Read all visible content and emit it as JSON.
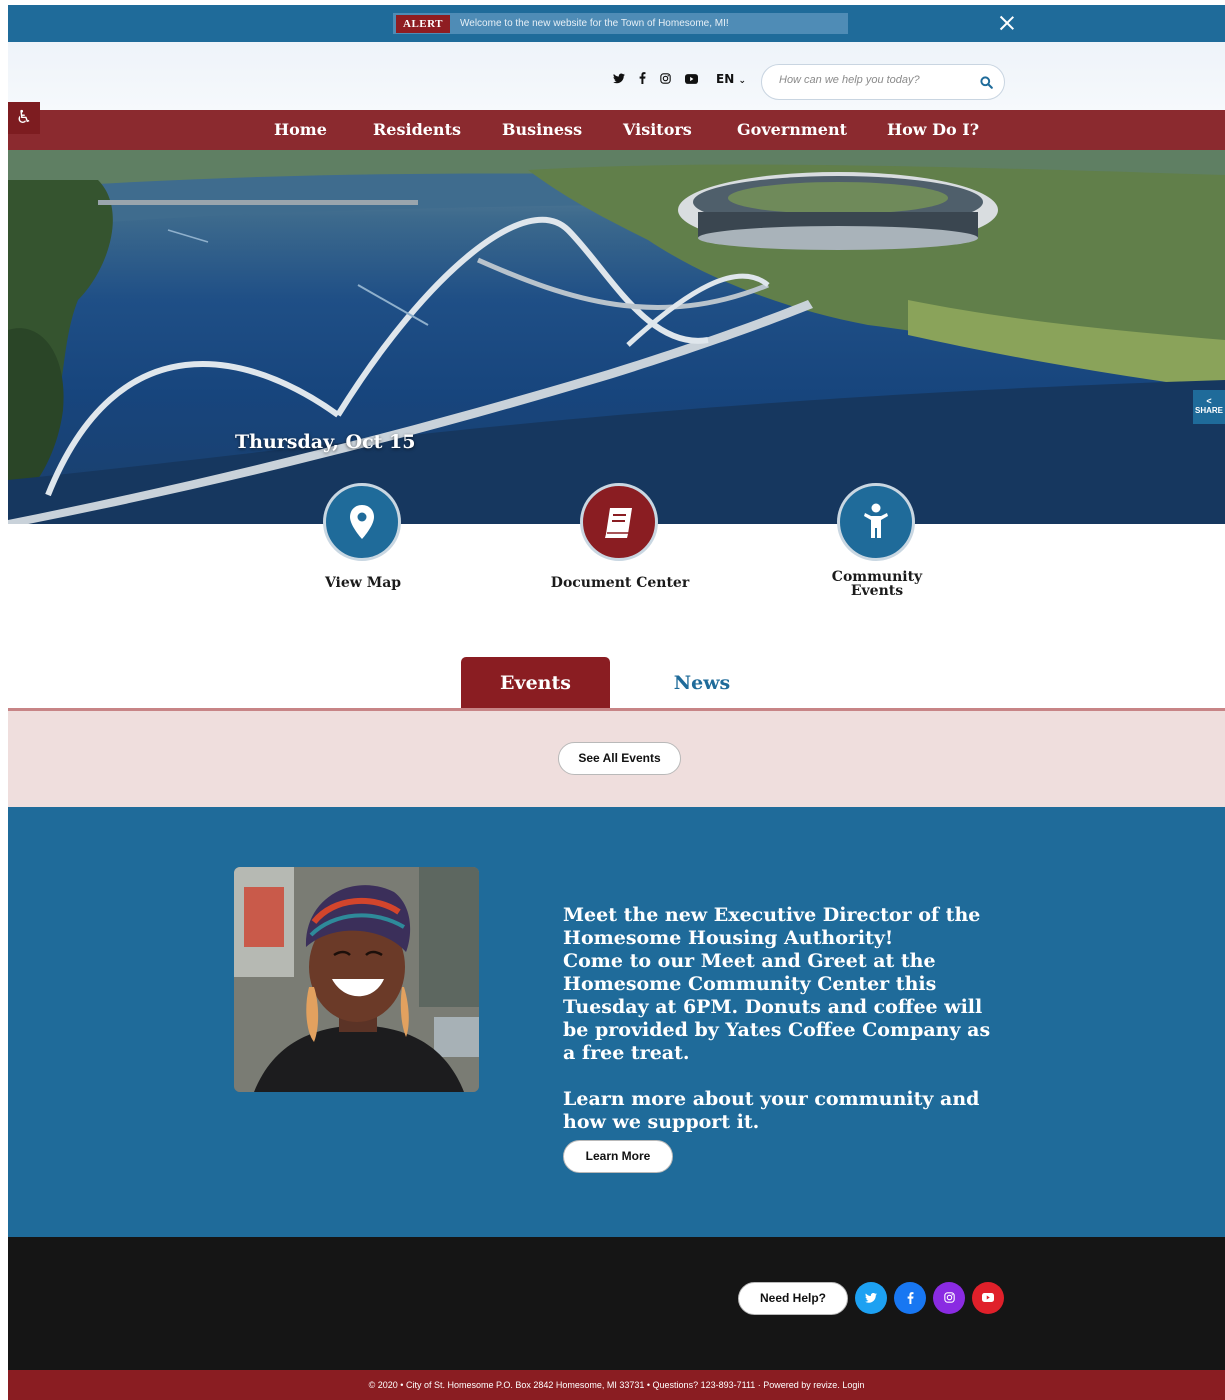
{
  "alert": {
    "tag": "ALERT",
    "message": "Welcome to the new website for the Town of Homesome, MI!"
  },
  "utility": {
    "social_icons": [
      "twitter-icon",
      "facebook-icon",
      "instagram-icon",
      "youtube-icon"
    ],
    "language": "EN",
    "search_placeholder": "How can we help you today?"
  },
  "nav": {
    "items": [
      "Home",
      "Residents",
      "Business",
      "Visitors",
      "Government",
      "How Do I?"
    ]
  },
  "hero": {
    "date": "Thursday, Oct 15",
    "share_label": "SHARE"
  },
  "quick_links": [
    {
      "label": "View Map",
      "icon": "map-pin-icon",
      "color": "#1f6b9a"
    },
    {
      "label": "Document Center",
      "icon": "book-icon",
      "color": "#8a1d22"
    },
    {
      "label": "Community Events",
      "icon": "person-icon",
      "color": "#1f6b9a"
    }
  ],
  "tabs": {
    "events": "Events",
    "news": "News",
    "see_all": "See All Events"
  },
  "feature": {
    "lines": [
      "Meet the new Executive Director of the Homesome Housing Authority!",
      "Come to our Meet and Greet at the Homesome Community Center this Tuesday at 6PM.  Donuts and coffee will be provided by Yates Coffee Company as a free treat.",
      "Learn more about your community and how we support it."
    ],
    "button": "Learn More"
  },
  "footer": {
    "need_help": "Need Help?",
    "social": [
      {
        "icon": "twitter-icon",
        "color": "#1da1f2"
      },
      {
        "icon": "facebook-icon",
        "color": "#1877f2"
      },
      {
        "icon": "instagram-icon",
        "color": "#8a2be2"
      },
      {
        "icon": "youtube-icon",
        "color": "#e0202a"
      }
    ],
    "copyright": "© 2020 • City of St. Homesome P.O. Box 2842 Homesome, MI 33731 • Questions? 123-893-7111  ·  Powered by revize. Login"
  },
  "colors": {
    "primary_blue": "#1f6b9a",
    "primary_red": "#8a1d22",
    "events_panel": "#efdedd",
    "footer": "#151515"
  }
}
